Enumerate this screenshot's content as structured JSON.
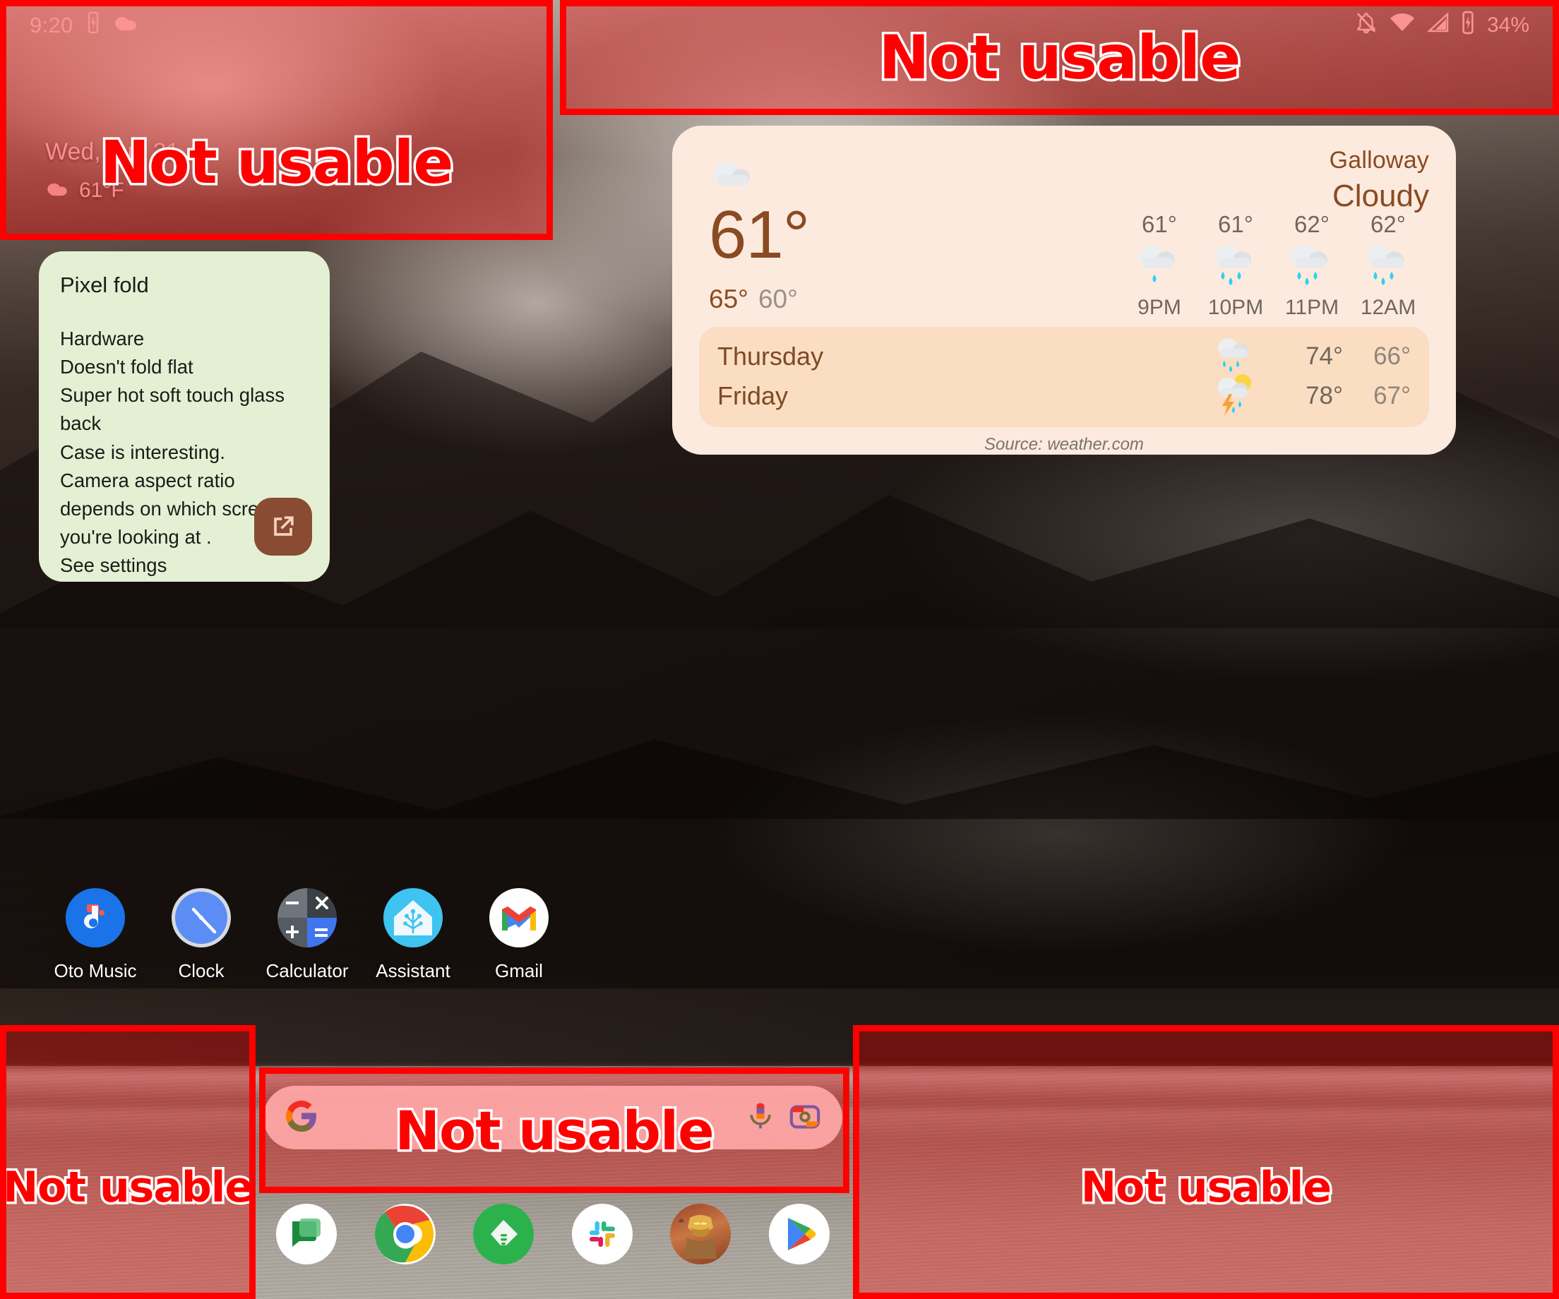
{
  "status_bar": {
    "time": "9:20",
    "left_icons": [
      "battery-charging-icon",
      "cloud-icon"
    ],
    "right_icons": [
      "notifications-muted-icon",
      "wifi-icon",
      "cellular-signal-icon",
      "battery-charging-icon"
    ],
    "battery_percent": "34%"
  },
  "lockscreen": {
    "date": "Wed, Jun 21",
    "temperature": "61°F",
    "weather_icon": "cloud-icon"
  },
  "note_widget": {
    "title": "Pixel fold",
    "body": "Hardware\nDoesn't fold flat\nSuper hot soft touch glass back\nCase is interesting.\nCamera aspect ratio depends on which screen you're looking at .\nSee settings\n\nNo way to close phone without locking it?",
    "open_button_icon": "open-in-new-icon",
    "background_color": "#e4f0d4",
    "fab_color": "#8a4b33"
  },
  "weather_widget": {
    "city": "Galloway",
    "condition": "Cloudy",
    "condition_icon": "cloud-icon",
    "current_temp": "61°",
    "high": "65°",
    "low": "60°",
    "background_color": "#fdeade",
    "accent_color": "#8a4b22",
    "hourly": [
      {
        "temp": "61°",
        "time": "9PM",
        "icon": "cloud-rain-light-icon",
        "drops": 1
      },
      {
        "temp": "61°",
        "time": "10PM",
        "icon": "cloud-rain-icon",
        "drops": 3
      },
      {
        "temp": "62°",
        "time": "11PM",
        "icon": "cloud-rain-icon",
        "drops": 3
      },
      {
        "temp": "62°",
        "time": "12AM",
        "icon": "cloud-rain-icon",
        "drops": 3
      }
    ],
    "daily": [
      {
        "day": "Thursday",
        "icon": "cloud-rain-icon",
        "high": "74°",
        "low": "66°"
      },
      {
        "day": "Friday",
        "icon": "thunderstorm-sun-icon",
        "high": "78°",
        "low": "67°"
      }
    ],
    "source": "Source: weather.com"
  },
  "app_grid": [
    {
      "label": "Oto Music",
      "icon": "oto-music-icon"
    },
    {
      "label": "Clock",
      "icon": "clock-icon"
    },
    {
      "label": "Calculator",
      "icon": "calculator-icon"
    },
    {
      "label": "Assistant",
      "icon": "home-assistant-icon"
    },
    {
      "label": "Gmail",
      "icon": "gmail-icon"
    }
  ],
  "search_bar": {
    "logo_icon": "google-g-icon",
    "mic_icon": "microphone-icon",
    "lens_icon": "google-lens-camera-icon"
  },
  "dock": [
    {
      "label": "Messages",
      "icon": "google-messages-icon"
    },
    {
      "label": "Chrome",
      "icon": "chrome-icon"
    },
    {
      "label": "Feedly",
      "icon": "feedly-icon"
    },
    {
      "label": "Slack",
      "icon": "slack-icon"
    },
    {
      "label": "Game",
      "icon": "game-avatar-icon"
    },
    {
      "label": "Play Store",
      "icon": "play-store-icon"
    }
  ],
  "overlays": {
    "label": "Not usable",
    "color": "#ff0000",
    "regions": [
      "top-left",
      "top-right",
      "bottom-left",
      "bottom-center",
      "bottom-right"
    ]
  }
}
